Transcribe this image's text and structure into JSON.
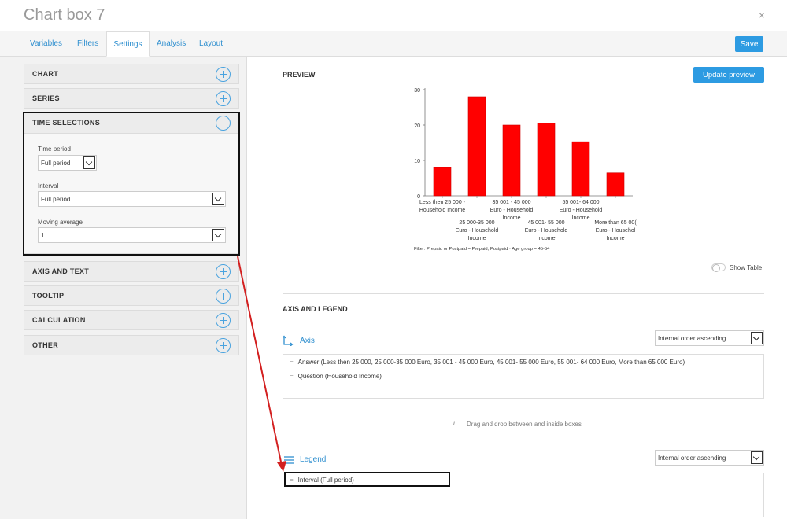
{
  "window": {
    "title": "Chart box 7",
    "close": "×"
  },
  "tabs": [
    {
      "label": "Variables"
    },
    {
      "label": "Filters"
    },
    {
      "label": "Settings",
      "active": true
    },
    {
      "label": "Analysis"
    },
    {
      "label": "Layout"
    }
  ],
  "toolbar": {
    "save_label": "Save"
  },
  "sidebar": {
    "sections": [
      {
        "label": "CHART"
      },
      {
        "label": "SERIES"
      },
      {
        "label": "TIME SELECTIONS",
        "expanded": true
      },
      {
        "label": "AXIS AND TEXT"
      },
      {
        "label": "TOOLTIP"
      },
      {
        "label": "CALCULATION"
      },
      {
        "label": "OTHER"
      }
    ],
    "time_selections": {
      "time_period_label": "Time period",
      "time_period_value": "Full period",
      "interval_label": "Interval",
      "interval_value": "Full period",
      "moving_average_label": "Moving average",
      "moving_average_value": "1"
    }
  },
  "preview": {
    "title": "PREVIEW",
    "update_label": "Update preview",
    "show_table_label": "Show Table",
    "filter_note": "Filter: Prepaid or Postpaid = Prepaid, Postpaid · Age group = 45-54"
  },
  "chart_data": {
    "type": "bar",
    "categories": [
      [
        "Less then 25 000 -",
        "Household Income"
      ],
      [
        "25 000-35 000",
        "Euro - Household",
        "Income"
      ],
      [
        "35 001 - 45 000",
        "Euro - Household",
        "Income"
      ],
      [
        "45 001- 55 000",
        "Euro - Household",
        "Income"
      ],
      [
        "55 001- 64 000",
        "Euro - Household",
        "Income"
      ],
      [
        "More than 65 00(",
        "Euro - Househol",
        "Income"
      ]
    ],
    "values": [
      8,
      28,
      20,
      20.5,
      15.3,
      6.5
    ],
    "ylim": [
      0,
      30
    ],
    "yticks": [
      0,
      10,
      20,
      30
    ],
    "bar_color": "#ff0000",
    "grid": false
  },
  "axis_legend": {
    "title": "AXIS AND LEGEND",
    "axis_label": "Axis",
    "axis_order": "Internal order ascending",
    "axis_items": [
      "Answer (Less then 25 000, 25 000-35 000 Euro, 35 001 - 45 000 Euro, 45 001- 55 000 Euro, 55 001- 64 000 Euro, More than 65 000 Euro)",
      "Question (Household Income)"
    ],
    "drag_hint_icon": "i",
    "drag_hint": "Drag and drop between and inside boxes",
    "legend_label": "Legend",
    "legend_order": "Internal order ascending",
    "legend_items": [
      "Interval (Full period)"
    ]
  },
  "colors": {
    "accent": "#2d9be2",
    "annotation": "#d32020"
  }
}
